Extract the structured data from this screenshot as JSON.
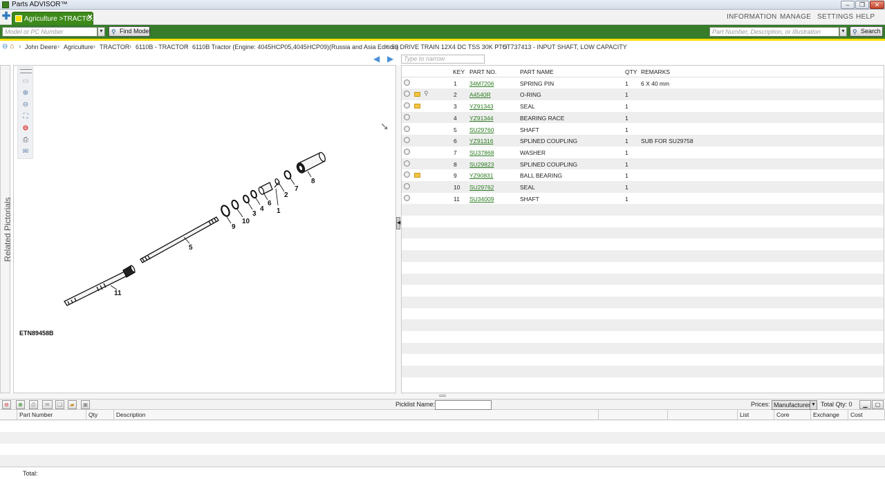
{
  "window": {
    "title": "Parts ADVISOR™"
  },
  "tabs": [
    {
      "label": "Agriculture >TRACTO..."
    }
  ],
  "top_menu": [
    "INFORMATION",
    "MANAGE",
    "SETTINGS",
    "HELP"
  ],
  "searchbar": {
    "model_placeholder": "Model or PC Number",
    "find_model_label": "Find Model",
    "part_placeholder": "Part Number, Description, or Illustration",
    "search_label": "Search"
  },
  "breadcrumbs": [
    "John Deere",
    "Agriculture",
    "TRACTOR",
    "6110B - TRACTOR",
    "6110B Tractor (Engine: 4045HCP05,4045HCP09)(Russia and Asia Edition)",
    "53 DRIVE TRAIN 12X4 DC TSS 30K PTO",
    "ST737413 - INPUT SHAFT, LOW CAPACITY"
  ],
  "left_panel": {
    "related_pictorials": "Related Pictorials",
    "illustration_id": "ETN89458B",
    "callouts": [
      "1",
      "2",
      "3",
      "4",
      "5",
      "6",
      "7",
      "8",
      "9",
      "10",
      "11"
    ]
  },
  "parts_table": {
    "filter_placeholder": "Type to narrow",
    "headers": {
      "key": "KEY",
      "part_no": "PART NO.",
      "part_name": "PART NAME",
      "qty": "QTY",
      "remarks": "REMARKS"
    },
    "rows": [
      {
        "key": "1",
        "part_no": "34M7206",
        "part_name": "SPRING PIN",
        "qty": "1",
        "remarks": "6 X 40 mm",
        "folder": false,
        "clip": false
      },
      {
        "key": "2",
        "part_no": "A4540R",
        "part_name": "O-RING",
        "qty": "1",
        "remarks": "",
        "folder": true,
        "clip": true
      },
      {
        "key": "3",
        "part_no": "YZ91343",
        "part_name": "SEAL",
        "qty": "1",
        "remarks": "",
        "folder": true,
        "clip": false
      },
      {
        "key": "4",
        "part_no": "YZ91344",
        "part_name": "BEARING RACE",
        "qty": "1",
        "remarks": "",
        "folder": false,
        "clip": false
      },
      {
        "key": "5",
        "part_no": "SU29760",
        "part_name": "SHAFT",
        "qty": "1",
        "remarks": "",
        "folder": false,
        "clip": false
      },
      {
        "key": "6",
        "part_no": "YZ91316",
        "part_name": "SPLINED COUPLING",
        "qty": "1",
        "remarks": "SUB FOR SU29758",
        "folder": false,
        "clip": false
      },
      {
        "key": "7",
        "part_no": "SU37868",
        "part_name": "WASHER",
        "qty": "1",
        "remarks": "",
        "folder": false,
        "clip": false
      },
      {
        "key": "8",
        "part_no": "SU29823",
        "part_name": "SPLINED COUPLING",
        "qty": "1",
        "remarks": "",
        "folder": false,
        "clip": false
      },
      {
        "key": "9",
        "part_no": "YZ90831",
        "part_name": "BALL BEARING",
        "qty": "1",
        "remarks": "",
        "folder": true,
        "clip": false
      },
      {
        "key": "10",
        "part_no": "SU29762",
        "part_name": "SEAL",
        "qty": "1",
        "remarks": "",
        "folder": false,
        "clip": false
      },
      {
        "key": "11",
        "part_no": "SU34009",
        "part_name": "SHAFT",
        "qty": "1",
        "remarks": "",
        "folder": false,
        "clip": false
      }
    ]
  },
  "picklist": {
    "name_label": "Picklist Name:",
    "prices_label": "Prices:",
    "prices_value": "Manufacturer",
    "total_qty": "Total Qty: 0",
    "columns": [
      "Part Number",
      "Qty",
      "Description",
      "",
      "",
      "List",
      "Core",
      "Exchange",
      "Cost"
    ],
    "total_label": "Total:"
  },
  "colors": {
    "brand_green": "#367c2b",
    "brand_yellow": "#ffde00",
    "link_green": "#2a7a1f"
  }
}
